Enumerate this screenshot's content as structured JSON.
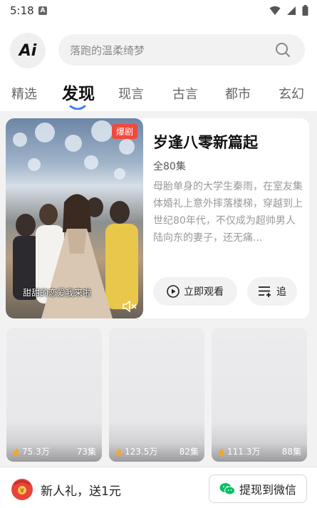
{
  "status_bar": {
    "time": "5:18",
    "notif_letter": "A"
  },
  "header": {
    "logo_text": "Ai",
    "search_placeholder": "落跑的温柔绮梦",
    "tabs": [
      {
        "label": "精选"
      },
      {
        "label": "发现",
        "active": true
      },
      {
        "label": "现言"
      },
      {
        "label": "古言"
      },
      {
        "label": "都市"
      },
      {
        "label": "玄幻"
      }
    ]
  },
  "featured": {
    "badge": "爆剧",
    "poster_caption": "甜甜的恋爱我来啦",
    "title": "岁逢八零新篇起",
    "episodes": "全80集",
    "description": "母胎单身的大学生秦雨，在室友集体婚礼上意外摔落楼梯，穿越到上世纪80年代，不仅成为超帅男人陆向东的妻子，还无痛...",
    "watch_label": "立即观看",
    "follow_label": "追"
  },
  "grid": [
    {
      "views": "75.3万",
      "episodes": "73集"
    },
    {
      "views": "123.5万",
      "episodes": "82集"
    },
    {
      "views": "111.3万",
      "episodes": "88集"
    }
  ],
  "bottom_bar": {
    "gift_text": "新人礼，送1元",
    "withdraw_label": "提现到微信"
  },
  "colors": {
    "badge": "#f04a3e",
    "tab_underline": "#3d7bf2",
    "wechat_green": "#07c160",
    "flame": "#f5a623"
  }
}
